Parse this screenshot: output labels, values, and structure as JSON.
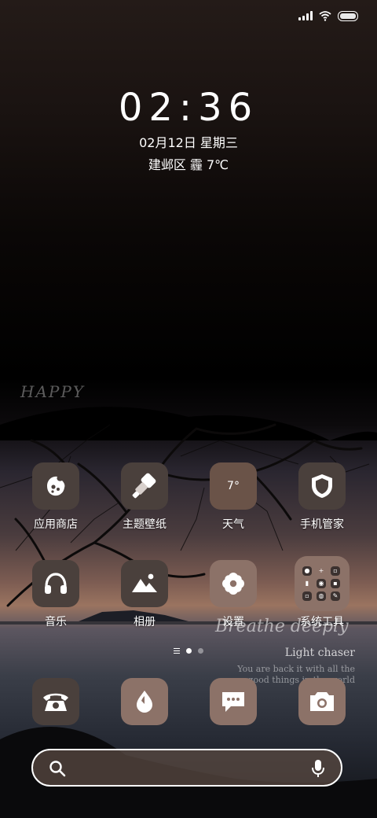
{
  "clock": {
    "time": "02:36",
    "date": "02月12日 星期三",
    "weather": "建邺区 霾 7℃"
  },
  "decor": {
    "happy": "HAPPY",
    "quote_title": "Breathe deeply",
    "quote_sub": "Light chaser",
    "quote_body": "You are back it with all the good things in the world"
  },
  "apps": [
    {
      "label": "应用商店",
      "icon": "app-store-icon"
    },
    {
      "label": "主题壁纸",
      "icon": "theme-brush-icon"
    },
    {
      "label": "天气",
      "icon": "weather-icon",
      "value": "7°"
    },
    {
      "label": "手机管家",
      "icon": "shield-icon"
    },
    {
      "label": "音乐",
      "icon": "headphones-icon"
    },
    {
      "label": "相册",
      "icon": "gallery-icon"
    },
    {
      "label": "设置",
      "icon": "gear-icon"
    },
    {
      "label": "系统工具",
      "icon": "folder-icon"
    }
  ],
  "dock": [
    {
      "name": "phone",
      "icon": "phone-icon"
    },
    {
      "name": "browser",
      "icon": "browser-icon"
    },
    {
      "name": "messages",
      "icon": "message-icon"
    },
    {
      "name": "camera",
      "icon": "camera-icon"
    }
  ],
  "pager": {
    "pages": 2,
    "active": 1
  },
  "search": {
    "placeholder": ""
  },
  "colors": {
    "dark_tile": "#4a403c",
    "light_tile": "#8c7268"
  }
}
